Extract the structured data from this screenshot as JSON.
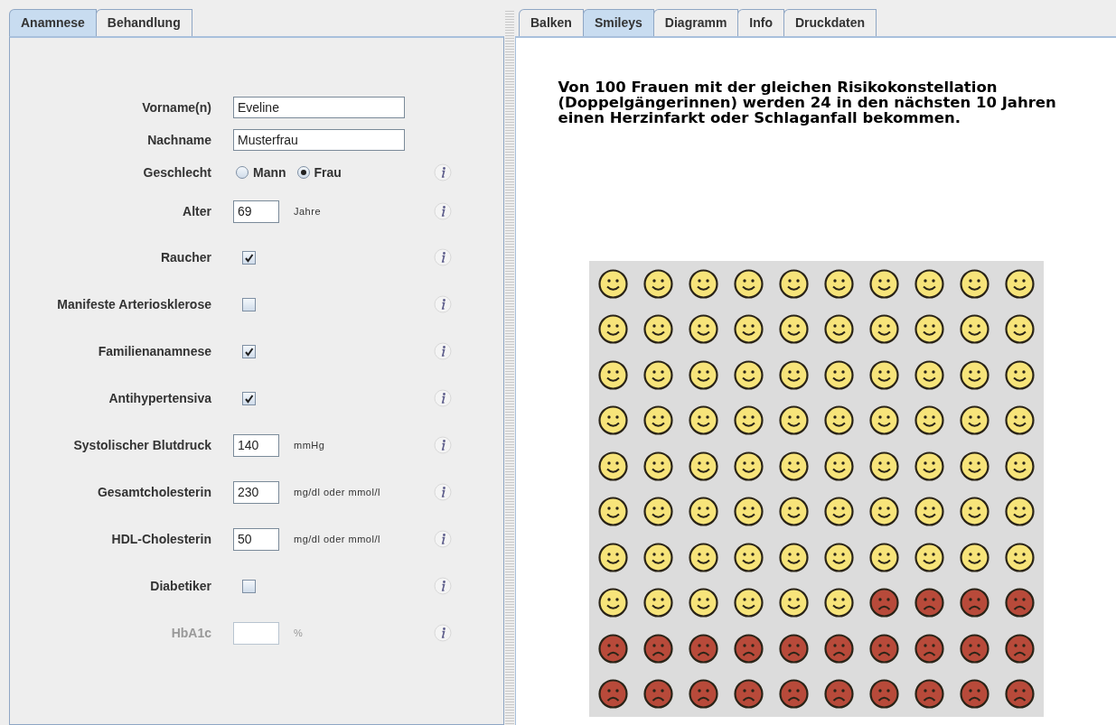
{
  "left_tabs": [
    {
      "label": "Anamnese",
      "selected": true
    },
    {
      "label": "Behandlung",
      "selected": false
    }
  ],
  "fields": [
    {
      "label": "Vorname(n)",
      "kind": "text",
      "value": "Eveline",
      "info": false,
      "disabled": false
    },
    {
      "label": "Nachname",
      "kind": "text",
      "value": "Musterfrau",
      "info": false,
      "disabled": false
    },
    {
      "label": "Geschlecht",
      "kind": "radio",
      "options": [
        {
          "label": "Mann",
          "selected": false
        },
        {
          "label": "Frau",
          "selected": true
        }
      ],
      "info": true,
      "disabled": false
    },
    {
      "label": "Alter",
      "kind": "number",
      "value": "69",
      "unit": "Jahre",
      "info": true,
      "disabled": false
    },
    {
      "label": "Raucher",
      "kind": "checkbox",
      "checked": true,
      "info": true,
      "disabled": false
    },
    {
      "label": "Manifeste Arteriosklerose",
      "kind": "checkbox",
      "checked": false,
      "info": true,
      "disabled": false
    },
    {
      "label": "Familienanamnese",
      "kind": "checkbox",
      "checked": true,
      "info": true,
      "disabled": false
    },
    {
      "label": "Antihypertensiva",
      "kind": "checkbox",
      "checked": true,
      "info": true,
      "disabled": false
    },
    {
      "label": "Systolischer Blutdruck",
      "kind": "number",
      "value": "140",
      "unit": "mmHg",
      "info": true,
      "disabled": false
    },
    {
      "label": "Gesamtcholesterin",
      "kind": "number",
      "value": "230",
      "unit": "mg/dl oder mmol/l",
      "info": true,
      "disabled": false
    },
    {
      "label": "HDL-Cholesterin",
      "kind": "number",
      "value": "50",
      "unit": "mg/dl oder mmol/l",
      "info": true,
      "disabled": false
    },
    {
      "label": "Diabetiker",
      "kind": "checkbox",
      "checked": false,
      "info": true,
      "disabled": false
    },
    {
      "label": "HbA1c",
      "kind": "number",
      "unit": "%",
      "info": true,
      "disabled": true
    }
  ],
  "right_tabs": [
    {
      "label": "Balken",
      "selected": false
    },
    {
      "label": "Smileys",
      "selected": true
    },
    {
      "label": "Diagramm",
      "selected": false
    },
    {
      "label": "Info",
      "selected": false
    },
    {
      "label": "Druckdaten",
      "selected": false
    }
  ],
  "result_text": "Von 100 Frauen mit der gleichen Risikokonstellation (Doppelgängerinnen) werden 24 in den nächsten 10 Jahren einen Herzinfarkt oder Schlaganfall bekommen.",
  "smiley_grid": [
    [
      {
        "kind": "happy"
      },
      {
        "kind": "happy"
      },
      {
        "kind": "happy"
      },
      {
        "kind": "happy"
      },
      {
        "kind": "happy"
      },
      {
        "kind": "happy"
      },
      {
        "kind": "happy"
      },
      {
        "kind": "happy"
      },
      {
        "kind": "happy"
      },
      {
        "kind": "happy"
      }
    ],
    [
      {
        "kind": "happy"
      },
      {
        "kind": "happy"
      },
      {
        "kind": "happy"
      },
      {
        "kind": "happy"
      },
      {
        "kind": "happy"
      },
      {
        "kind": "happy"
      },
      {
        "kind": "happy"
      },
      {
        "kind": "happy"
      },
      {
        "kind": "happy"
      },
      {
        "kind": "happy"
      }
    ],
    [
      {
        "kind": "happy"
      },
      {
        "kind": "happy"
      },
      {
        "kind": "happy"
      },
      {
        "kind": "happy"
      },
      {
        "kind": "happy"
      },
      {
        "kind": "happy"
      },
      {
        "kind": "happy"
      },
      {
        "kind": "happy"
      },
      {
        "kind": "happy"
      },
      {
        "kind": "happy"
      }
    ],
    [
      {
        "kind": "happy"
      },
      {
        "kind": "happy"
      },
      {
        "kind": "happy"
      },
      {
        "kind": "happy"
      },
      {
        "kind": "happy"
      },
      {
        "kind": "happy"
      },
      {
        "kind": "happy"
      },
      {
        "kind": "happy"
      },
      {
        "kind": "happy"
      },
      {
        "kind": "happy"
      }
    ],
    [
      {
        "kind": "happy"
      },
      {
        "kind": "happy"
      },
      {
        "kind": "happy"
      },
      {
        "kind": "happy"
      },
      {
        "kind": "happy"
      },
      {
        "kind": "happy"
      },
      {
        "kind": "happy"
      },
      {
        "kind": "happy"
      },
      {
        "kind": "happy"
      },
      {
        "kind": "happy"
      }
    ],
    [
      {
        "kind": "happy"
      },
      {
        "kind": "happy"
      },
      {
        "kind": "happy"
      },
      {
        "kind": "happy"
      },
      {
        "kind": "happy"
      },
      {
        "kind": "happy"
      },
      {
        "kind": "happy"
      },
      {
        "kind": "happy"
      },
      {
        "kind": "happy"
      },
      {
        "kind": "happy"
      }
    ],
    [
      {
        "kind": "happy"
      },
      {
        "kind": "happy"
      },
      {
        "kind": "happy"
      },
      {
        "kind": "happy"
      },
      {
        "kind": "happy"
      },
      {
        "kind": "happy"
      },
      {
        "kind": "happy"
      },
      {
        "kind": "happy"
      },
      {
        "kind": "happy"
      },
      {
        "kind": "happy"
      }
    ],
    [
      {
        "kind": "happy"
      },
      {
        "kind": "happy"
      },
      {
        "kind": "happy"
      },
      {
        "kind": "happy"
      },
      {
        "kind": "happy"
      },
      {
        "kind": "happy"
      },
      {
        "kind": "sad"
      },
      {
        "kind": "sad"
      },
      {
        "kind": "sad"
      },
      {
        "kind": "sad"
      }
    ],
    [
      {
        "kind": "sad"
      },
      {
        "kind": "sad"
      },
      {
        "kind": "sad"
      },
      {
        "kind": "sad"
      },
      {
        "kind": "sad"
      },
      {
        "kind": "sad"
      },
      {
        "kind": "sad"
      },
      {
        "kind": "sad"
      },
      {
        "kind": "sad"
      },
      {
        "kind": "sad"
      }
    ],
    [
      {
        "kind": "sad"
      },
      {
        "kind": "sad"
      },
      {
        "kind": "sad"
      },
      {
        "kind": "sad"
      },
      {
        "kind": "sad"
      },
      {
        "kind": "sad"
      },
      {
        "kind": "sad"
      },
      {
        "kind": "sad"
      },
      {
        "kind": "sad"
      },
      {
        "kind": "sad"
      }
    ]
  ]
}
